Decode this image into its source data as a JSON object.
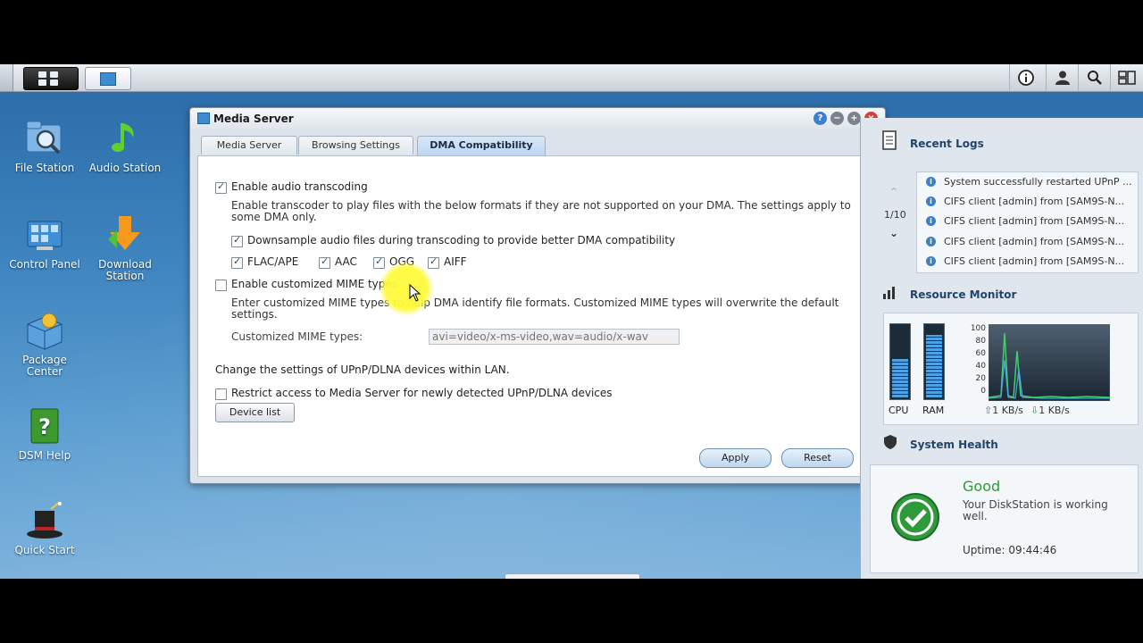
{
  "desktop": {
    "icons": [
      {
        "label": "File Station"
      },
      {
        "label": "Audio Station"
      },
      {
        "label": "Control Panel"
      },
      {
        "label": "Download Station"
      },
      {
        "label": "Package Center"
      },
      {
        "label": "DSM Help"
      },
      {
        "label": "Quick Start"
      }
    ]
  },
  "window": {
    "title": "Media Server",
    "tabs": [
      {
        "label": "Media Server"
      },
      {
        "label": "Browsing Settings"
      },
      {
        "label": "DMA Compatibility"
      }
    ],
    "audio_transcoding": {
      "label": "Enable audio transcoding",
      "checked": true,
      "description_line1": "Enable transcoder to play files with the below formats if they are not supported on your DMA. The settings apply to",
      "description_line2": "some DMA only.",
      "downsample_label": "Downsample audio files during transcoding to provide better DMA compatibility",
      "formats": [
        {
          "label": "FLAC/APE",
          "checked": true
        },
        {
          "label": "AAC",
          "checked": true
        },
        {
          "label": "OGG",
          "checked": true
        },
        {
          "label": "AIFF",
          "checked": true
        }
      ]
    },
    "mime": {
      "label": "Enable customized MIME types",
      "checked": false,
      "description_line1": "Enter customized MIME types to help DMA identify file formats. Customized MIME types will overwrite the default",
      "description_line2": "settings.",
      "field_label": "Customized MIME types:",
      "field_placeholder": "avi=video/x-ms-video,wav=audio/x-wav"
    },
    "upnp": {
      "info": "Change the settings of UPnP/DLNA devices within LAN.",
      "restrict_label": "Restrict access to Media Server for newly detected UPnP/DLNA devices",
      "device_list_button": "Device list"
    },
    "apply_button": "Apply",
    "reset_button": "Reset"
  },
  "widgets": {
    "recent_logs": {
      "title": "Recent Logs",
      "page": "1/10",
      "entries": [
        "System successfully restarted UPnP ...",
        "CIFS client [admin] from [SAM9S-N...",
        "CIFS client [admin] from [SAM9S-N...",
        "CIFS client [admin] from [SAM9S-N...",
        "CIFS client [admin] from [SAM9S-N..."
      ]
    },
    "resource_monitor": {
      "title": "Resource Monitor",
      "cpu_label": "CPU",
      "ram_label": "RAM",
      "cpu_level": 0.55,
      "ram_level": 0.88,
      "y_ticks": [
        "100",
        "80",
        "60",
        "40",
        "20",
        "0"
      ],
      "upload": "1 KB/s",
      "download": "1 KB/s"
    },
    "system_health": {
      "title": "System Health",
      "status": "Good",
      "message_line1": "Your DiskStation is working",
      "message_line2": "well.",
      "uptime": "Uptime: 09:44:46"
    }
  },
  "colors": {
    "accent": "#3d8bd0",
    "good": "#2e9a3a"
  }
}
